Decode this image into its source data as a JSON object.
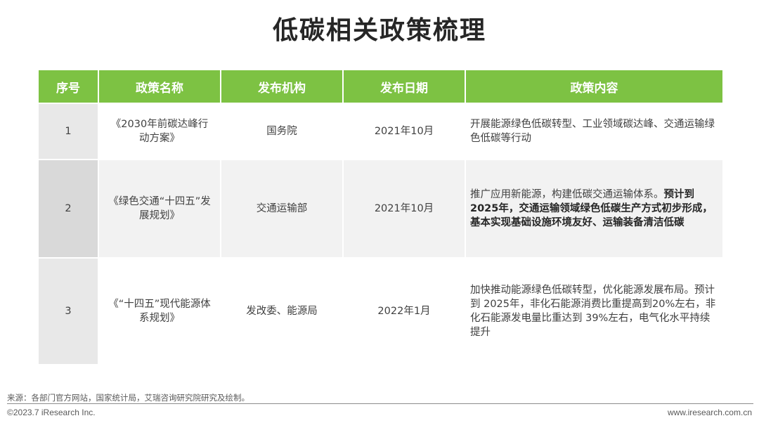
{
  "title": "低碳相关政策梳理",
  "table": {
    "headers": [
      "序号",
      "政策名称",
      "发布机构",
      "发布日期",
      "政策内容"
    ],
    "rows": [
      {
        "index": "1",
        "name": "《2030年前碳达峰行动方案》",
        "agency": "国务院",
        "date": "2021年10月",
        "content_normal": "开展能源绿色低碳转型、工业领域碳达峰、交通运输绿色低碳等行动",
        "content_bold": ""
      },
      {
        "index": "2",
        "name": "《绿色交通“十四五”发展规划》",
        "agency": "交通运输部",
        "date": "2021年10月",
        "content_normal": "推广应用新能源，构建低碳交通运输体系。",
        "content_bold": "预计到 2025年，交通运输领域绿色低碳生产方式初步形成，基本实现基础设施环境友好、运输装备清洁低碳"
      },
      {
        "index": "3",
        "name": "《“十四五”现代能源体系规划》",
        "agency": "发改委、能源局",
        "date": "2022年1月",
        "content_normal": "加快推动能源绿色低碳转型，优化能源发展布局。预计到 2025年，非化石能源消费比重提高到20%左右，非化石能源发电量比重达到 39%左右，电气化水平持续提升",
        "content_bold": ""
      }
    ]
  },
  "footer": {
    "source": "来源：各部门官方网站，国家统计局，艾瑞咨询研究院研究及绘制。",
    "copyright": "©2023.7 iResearch Inc.",
    "website": "www.iresearch.com.cn"
  },
  "colors": {
    "header_green": "#7dc243",
    "row_gray": "#f2f2f2",
    "index_gray": "#e8e8e8"
  }
}
